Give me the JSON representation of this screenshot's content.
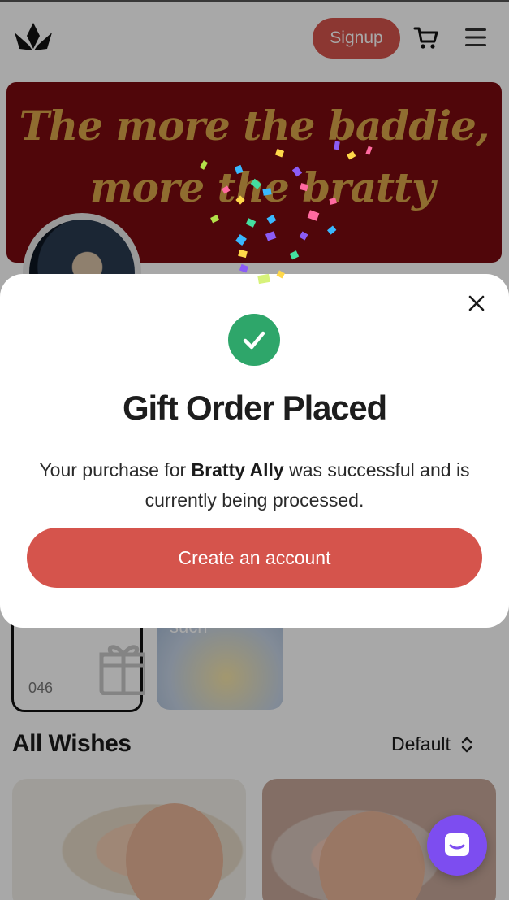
{
  "header": {
    "logo_icon": "crown-leaf-icon",
    "signup_label": "Signup",
    "cart_icon": "cart-icon",
    "menu_icon": "hamburger-menu-icon"
  },
  "banner": {
    "line1": "The more the baddie,",
    "line2": "more the bratty"
  },
  "gifts": {
    "count": "046",
    "tile_text": "such"
  },
  "wishes": {
    "title": "All Wishes",
    "sort_value": "Default"
  },
  "modal": {
    "title": "Gift Order Placed",
    "message_prefix": "Your purchase for ",
    "recipient": "Bratty Ally",
    "message_suffix": " was successful and is currently being processed.",
    "button_label": "Create an account"
  },
  "colors": {
    "accent": "#d5544c",
    "success": "#2ea66a",
    "chat": "#7d4df0",
    "banner_bg": "#7a0a10",
    "banner_text": "#d9a64a"
  }
}
